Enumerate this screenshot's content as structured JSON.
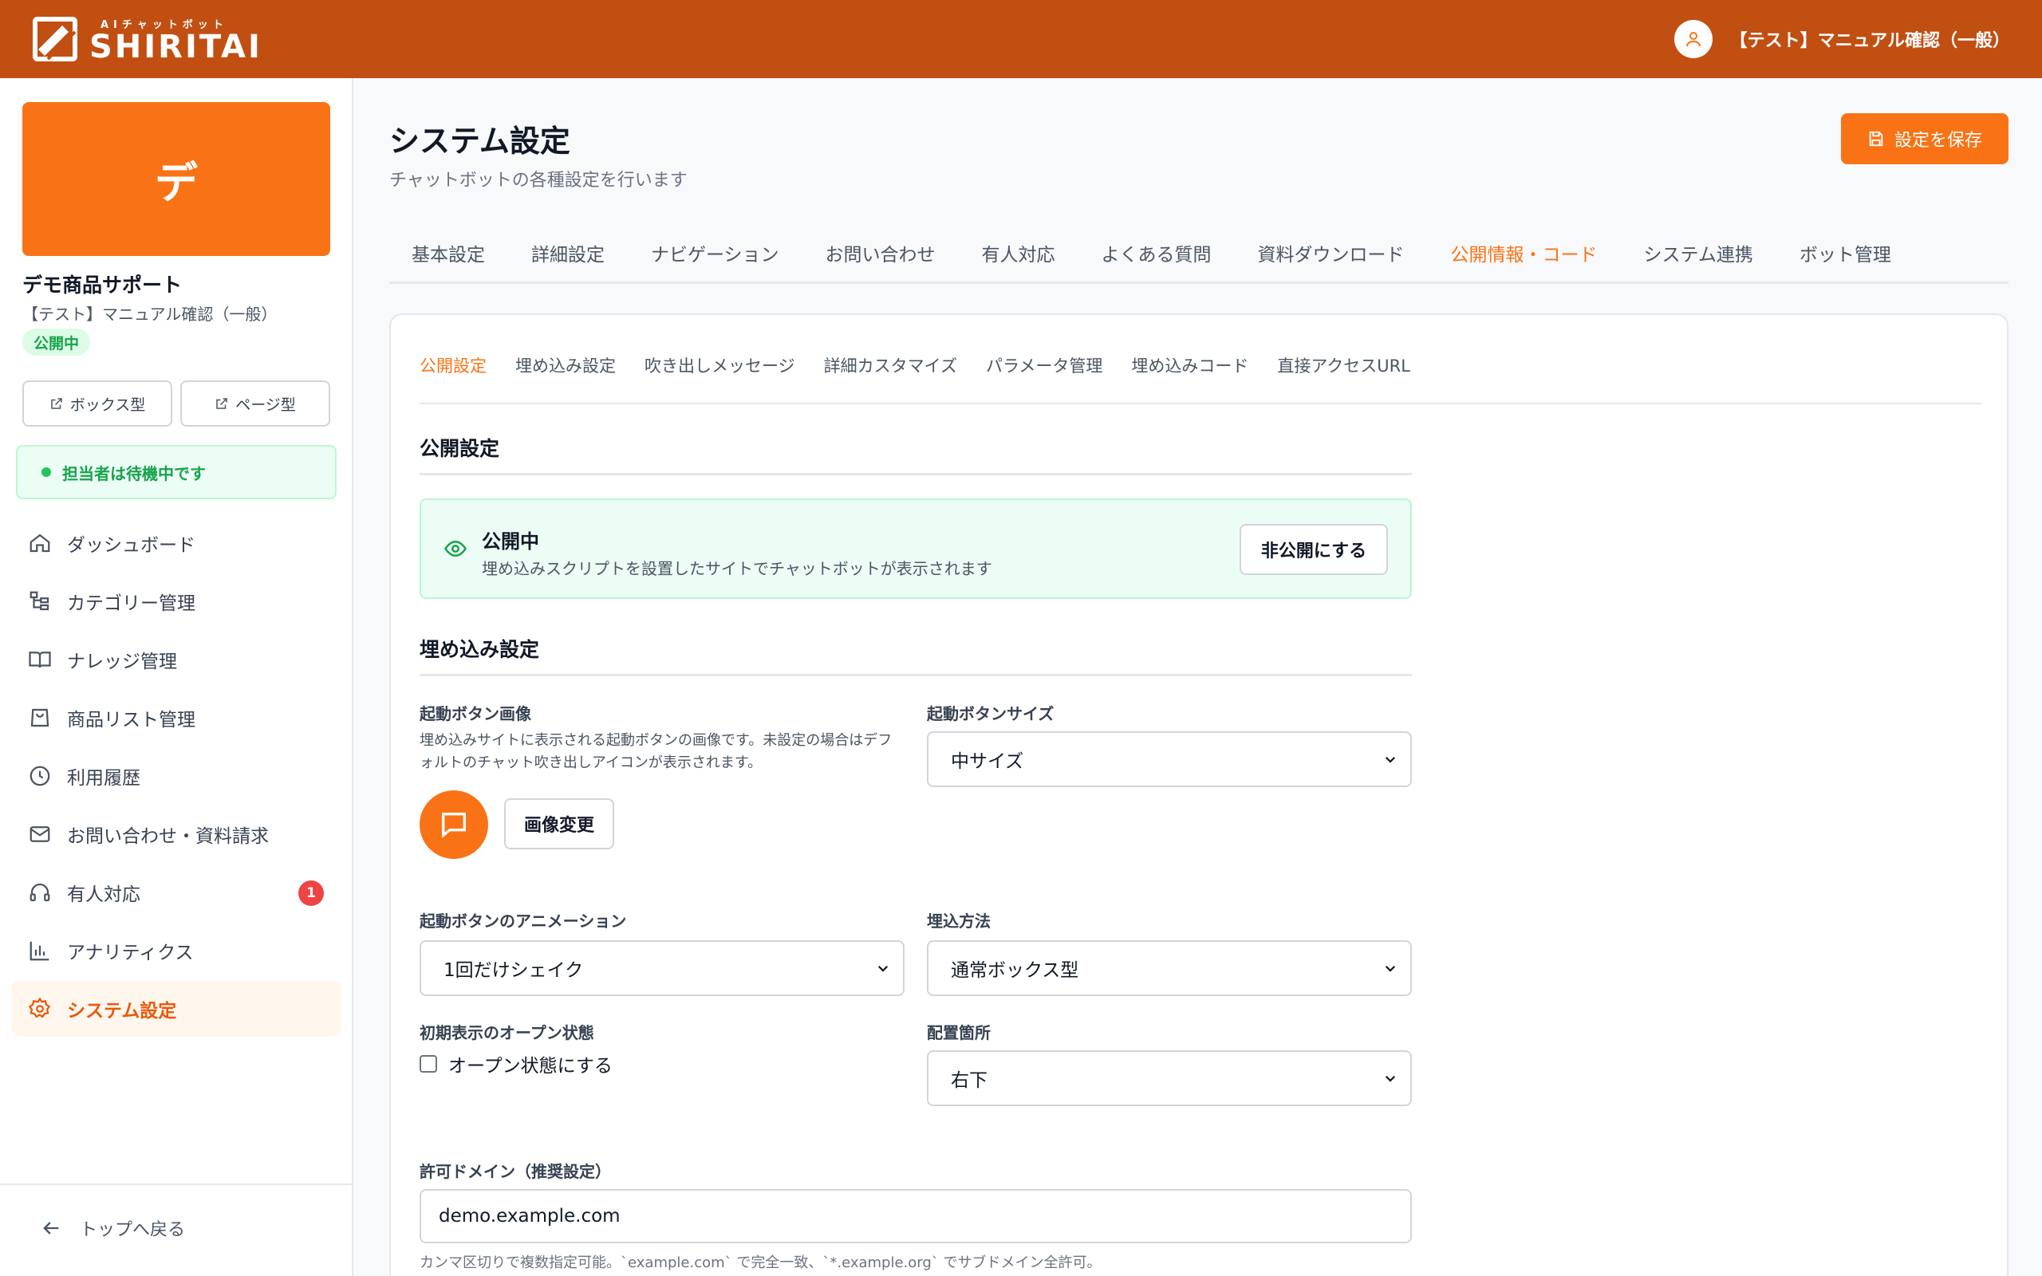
{
  "header": {
    "logo_sub": "AIチャットボット",
    "logo_main": "SHIRITAI",
    "user_name": "【テスト】マニュアル確認（一般）",
    "colors": {
      "bar": "#c14f12"
    }
  },
  "sidebar": {
    "bot_initial": "デ",
    "bot_name": "デモ商品サポート",
    "bot_org": "【テスト】マニュアル確認（一般）",
    "status_badge": "公開中",
    "box_type_label": "ボックス型",
    "page_type_label": "ページ型",
    "operator_status": "担当者は待機中です",
    "nav": [
      {
        "label": "ダッシュボード",
        "icon": "home-icon"
      },
      {
        "label": "カテゴリー管理",
        "icon": "category-tree-icon"
      },
      {
        "label": "ナレッジ管理",
        "icon": "book-icon"
      },
      {
        "label": "商品リスト管理",
        "icon": "shopping-bag-icon"
      },
      {
        "label": "利用履歴",
        "icon": "clock-icon"
      },
      {
        "label": "お問い合わせ・資料請求",
        "icon": "mail-icon"
      },
      {
        "label": "有人対応",
        "icon": "headset-icon",
        "badge": "1"
      },
      {
        "label": "アナリティクス",
        "icon": "bar-chart-icon"
      },
      {
        "label": "システム設定",
        "icon": "gear-icon",
        "active": true
      }
    ],
    "back_label": "トップへ戻る"
  },
  "main": {
    "title": "システム設定",
    "subtitle": "チャットボットの各種設定を行います",
    "save_label": "設定を保存",
    "tabs": [
      "基本設定",
      "詳細設定",
      "ナビゲーション",
      "お問い合わせ",
      "有人対応",
      "よくある質問",
      "資料ダウンロード",
      "公開情報・コード",
      "システム連携",
      "ボット管理"
    ],
    "active_tab": "公開情報・コード",
    "subtabs": [
      "公開設定",
      "埋め込み設定",
      "吹き出しメッセージ",
      "詳細カスタマイズ",
      "パラメータ管理",
      "埋め込みコード",
      "直接アクセスURL"
    ],
    "active_subtab": "公開設定",
    "publish": {
      "section_title": "公開設定",
      "status_title": "公開中",
      "status_desc": "埋め込みスクリプトを設置したサイトでチャットボットが表示されます",
      "unpublish_label": "非公開にする"
    },
    "embed": {
      "section_title": "埋め込み設定",
      "button_image_label": "起動ボタン画像",
      "button_image_help": "埋め込みサイトに表示される起動ボタンの画像です。未設定の場合はデフォルトのチャット吹き出しアイコンが表示されます。",
      "change_image_label": "画像変更",
      "button_size_label": "起動ボタンサイズ",
      "button_size_value": "中サイズ",
      "animation_label": "起動ボタンのアニメーション",
      "animation_value": "1回だけシェイク",
      "embed_method_label": "埋込方法",
      "embed_method_value": "通常ボックス型",
      "initial_open_label": "初期表示のオープン状態",
      "initial_open_checkbox": "オープン状態にする",
      "initial_open_checked": false,
      "position_label": "配置箇所",
      "position_value": "右下",
      "domain_label": "許可ドメイン（推奨設定）",
      "domain_value": "demo.example.com",
      "domain_hint": "カンマ区切りで複数指定可能。`example.com` で完全一致、`*.example.org` でサブドメイン全許可。"
    },
    "colors": {
      "accent": "#f97316",
      "success": "#16a34a"
    }
  }
}
